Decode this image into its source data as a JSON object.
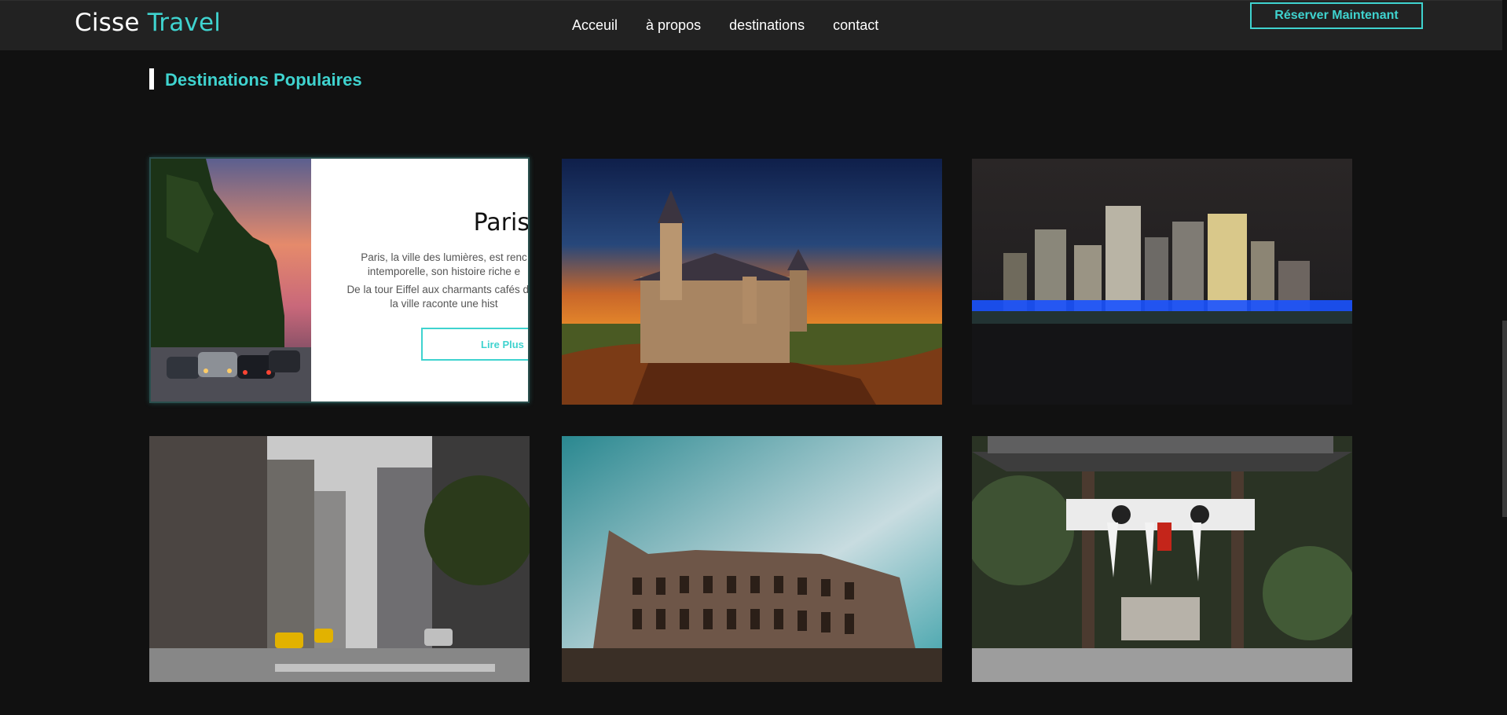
{
  "brand": {
    "part1": "Cisse",
    "part2": "Travel"
  },
  "nav": {
    "items": [
      "Acceuil",
      "à propos",
      "destinations",
      "contact"
    ]
  },
  "header": {
    "book_label": "Réserver Maintenant"
  },
  "section": {
    "title": "Destinations Populaires"
  },
  "featured": {
    "title": "Paris",
    "line1": "Paris, la ville des lumières, est renc",
    "line2": "intemporelle, son histoire riche e",
    "line3": "De la tour Eiffel aux charmants cafés de",
    "line4": "la ville raconte une hist",
    "button_label": "Lire Plus"
  },
  "colors": {
    "accent": "#3fd3cf",
    "background": "#111111",
    "navbar": "#222222"
  }
}
